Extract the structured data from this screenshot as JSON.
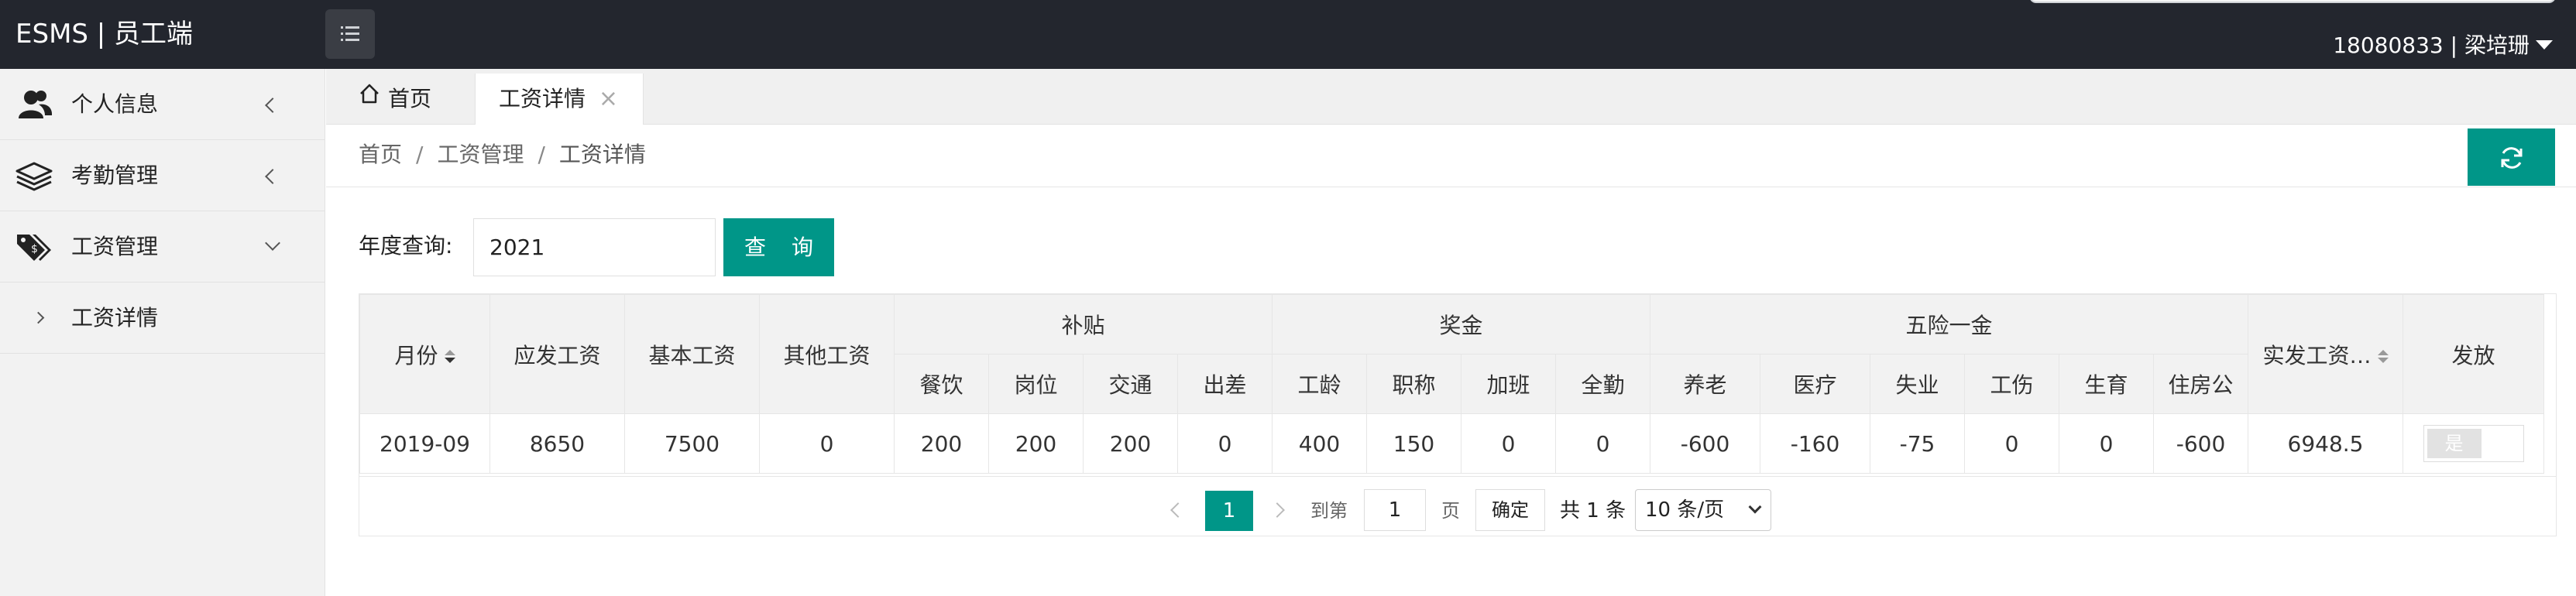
{
  "app": {
    "title": "ESMS | 员工端"
  },
  "header": {
    "user": "18080833 | 梁培珊"
  },
  "sidebar": {
    "items": [
      {
        "label": "个人信息",
        "icon": "users-icon"
      },
      {
        "label": "考勤管理",
        "icon": "layers-icon"
      },
      {
        "label": "工资管理",
        "icon": "tags-icon"
      }
    ],
    "subitems": [
      {
        "label": "工资详情"
      }
    ]
  },
  "tabs": {
    "home": "首页",
    "active": "工资详情",
    "close": "×"
  },
  "breadcrumb": {
    "home": "首页",
    "section": "工资管理",
    "page": "工资详情",
    "sep": "/"
  },
  "query": {
    "label": "年度查询:",
    "value": "2021",
    "button": "查 询"
  },
  "table": {
    "headers": {
      "month": "月份",
      "gross": "应发工资",
      "base": "基本工资",
      "other": "其他工资",
      "allowance": "补贴",
      "bonus": "奖金",
      "insurance": "五险一金",
      "net": "实发工资…",
      "issued": "发放"
    },
    "subheaders": {
      "allowance": [
        "餐饮",
        "岗位",
        "交通",
        "出差"
      ],
      "bonus": [
        "工龄",
        "职称",
        "加班",
        "全勤"
      ],
      "insurance": [
        "养老",
        "医疗",
        "失业",
        "工伤",
        "生育",
        "住房公"
      ]
    },
    "rows": [
      {
        "month": "2019-09",
        "gross": "8650",
        "base": "7500",
        "other": "0",
        "allowance": [
          "200",
          "200",
          "200",
          "0"
        ],
        "bonus": [
          "400",
          "150",
          "0",
          "0"
        ],
        "insurance": [
          "-600",
          "-160",
          "-75",
          "0",
          "0",
          "-600"
        ],
        "net": "6948.5",
        "issued": "是"
      }
    ]
  },
  "pager": {
    "current": "1",
    "goto_label": "到第",
    "goto_value": "1",
    "page_label": "页",
    "ok": "确定",
    "total": "共 1 条",
    "page_size": "10 条/页"
  },
  "colors": {
    "accent": "#009688",
    "header_bg": "#23262e"
  }
}
